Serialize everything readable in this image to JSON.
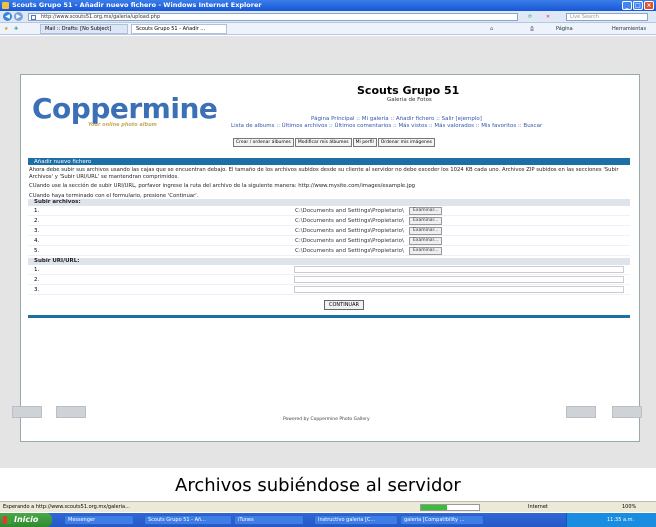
{
  "browser": {
    "title": "Scouts Grupo 51 - Añadir nuevo fichero - Windows Internet Explorer",
    "url": "http://www.scouts51.org.mx/galeria/upload.php",
    "search_placeholder": "Live Search",
    "tabs": [
      "Mail :: Drafts: [No Subject]",
      "Scouts Grupo 51 - Añadir ..."
    ],
    "toolbar": {
      "page": "Página",
      "tools": "Herramientas"
    }
  },
  "site": {
    "logo_word": "Coppermine",
    "logo_tagline": "Your online photo album",
    "title": "Scouts Grupo 51",
    "subtitle": "Galeria de Fotos",
    "nav_primary": [
      "Página Principal",
      "Mi galería",
      "Añadir fichero",
      "Salir [ejemplo]"
    ],
    "nav_secondary": [
      "Lista de albums",
      "Últimos archivos",
      "Últimos comentarios",
      "Más vistos",
      "Más valorados",
      "Mis favoritos",
      "Buscar"
    ],
    "admin_buttons": [
      "Crear / ordenar álbumes",
      "Modificar mis álbumes",
      "Mi perfil",
      "Ordenar mis imágenes"
    ]
  },
  "upload": {
    "header": "Añadir nuevo fichero",
    "intro": "Ahora debe subir sus archivos usando las cajas que se encuentran debajo. El tamaño de los archivos subidos desde su cliente al servidor no debe exceder los 1024 KB cada uno. Archivos ZIP subidos en las secciones 'Subir Archivos' y 'Subir URI/URL' se mantendran comprimidos.",
    "uri_hint": "CUando use la sección de subir URI/URL, porfavor ingrese la ruta del archivo de la siguiente manera: http://www.mysite.com/images/example.jpg",
    "done_hint": "CUando haya terminado con el formulario, presione 'Continuar'.",
    "files_section": "Subir archivos:",
    "file_rows": [
      {
        "num": "1.",
        "path": "C:\\Documents and Settings\\Propietario\\",
        "button": "Examinar..."
      },
      {
        "num": "2.",
        "path": "C:\\Documents and Settings\\Propietario\\",
        "button": "Examinar..."
      },
      {
        "num": "3.",
        "path": "C:\\Documents and Settings\\Propietario\\",
        "button": "Examinar..."
      },
      {
        "num": "4.",
        "path": "C:\\Documents and Settings\\Propietario\\",
        "button": "Examinar..."
      },
      {
        "num": "5.",
        "path": "C:\\Documents and Settings\\Propietario\\",
        "button": "Examinar..."
      }
    ],
    "uri_section": "Subir URI/URL:",
    "uri_rows": [
      "1.",
      "2.",
      "3."
    ],
    "submit": "CONTINUAR",
    "powered_by": "Powered by Coppermine Photo Gallery"
  },
  "caption": "Archivos subiéndose al servidor",
  "status": {
    "text": "Esperando a http://www.scouts51.org.mx/galeria...",
    "progress_fraction": 0.45,
    "zone": "Internet",
    "zoom": "100%"
  },
  "taskbar": {
    "start": "Inicio",
    "items": [
      "Messenger",
      "Scouts Grupo 51 - Añ...",
      "iTunes",
      "Instructivo galeria [C...",
      "galeria [Compatibility ..."
    ],
    "clock": "11:35 a.m."
  }
}
